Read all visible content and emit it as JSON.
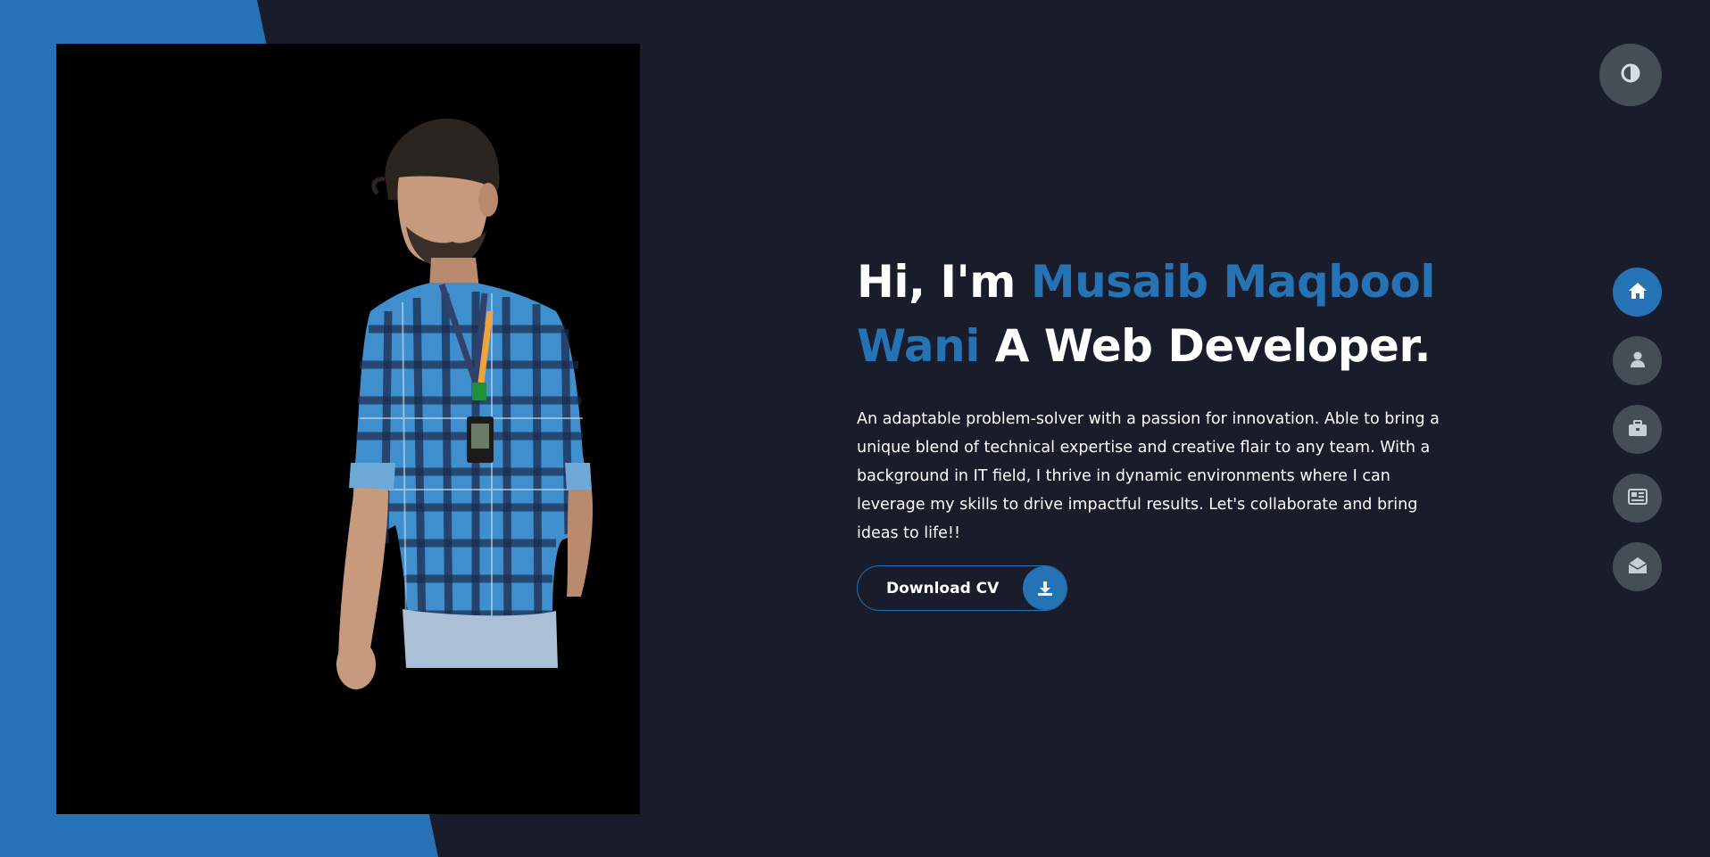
{
  "hero": {
    "greeting": "Hi, I'm ",
    "name_line1": "Musaib Maqbool",
    "name_line2": "Wani",
    "title_suffix": " A Web Developer.",
    "bio": "An adaptable problem-solver with a passion for innovation. Able to bring a unique blend of technical expertise and creative flair to any team. With a background in IT field, I thrive in dynamic environments where I can leverage my skills to drive impactful results. Let's collaborate and bring ideas to life!!",
    "cv_button_label": "Download CV"
  },
  "icons": {
    "theme_toggle": "contrast-icon",
    "cv": "download-icon",
    "nav": [
      "home-icon",
      "user-icon",
      "briefcase-icon",
      "newspaper-icon",
      "envelope-open-icon"
    ]
  },
  "nav": {
    "active_index": 0
  },
  "colors": {
    "background": "#191d2b",
    "accent": "#2572b4",
    "button_grey": "#454e56",
    "text": "#ffffff"
  }
}
